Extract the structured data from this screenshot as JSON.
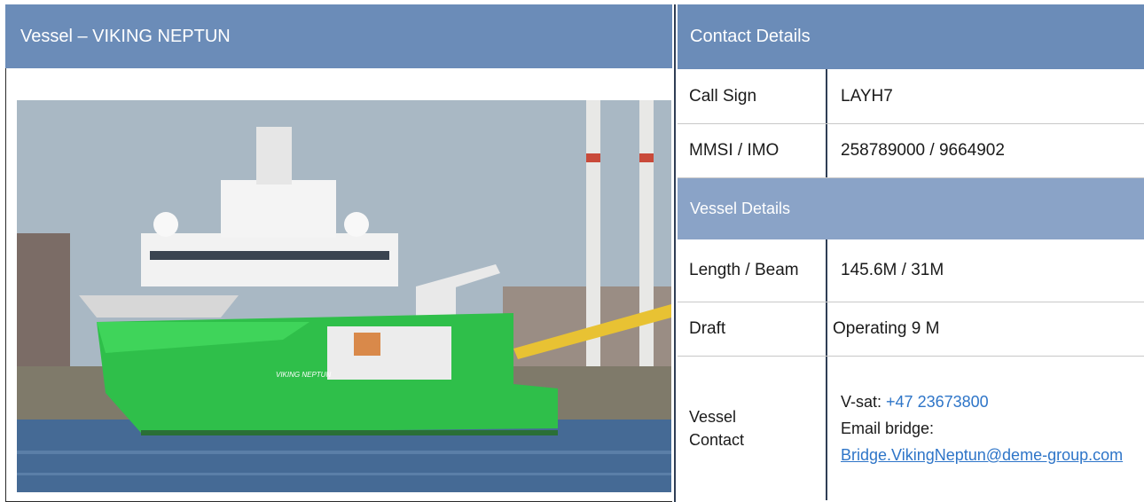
{
  "left": {
    "header": "Vessel – VIKING NEPTUN",
    "ship_name_on_hull": "VIKING NEPTUN"
  },
  "right": {
    "header": "Contact Details",
    "call_sign": {
      "label": "Call Sign",
      "value": "LAYH7"
    },
    "mmsi_imo": {
      "label": "MMSI / IMO",
      "value": "258789000 / 9664902"
    },
    "vessel_details_header": "Vessel Details",
    "length_beam": {
      "label": "Length / Beam",
      "value": "145.6M / 31M"
    },
    "draft": {
      "label": "Draft",
      "value": "Operating 9 M"
    },
    "vessel_contact": {
      "label": "Vessel Contact",
      "vsat_label": "V-sat: ",
      "vsat_number": "+47 23673800",
      "email_label": "Email bridge:",
      "email": "Bridge.VikingNeptun@deme-group.com"
    }
  },
  "colors": {
    "header_bg": "#6b8cb8",
    "subheader_bg": "#8aa3c7",
    "link": "#2e75c8",
    "hull_green": "#2fbf4a"
  }
}
